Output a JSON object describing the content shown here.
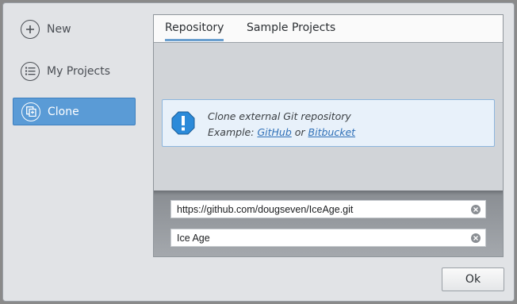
{
  "sidebar": {
    "items": [
      {
        "label": "New",
        "icon": "plus-circle-icon"
      },
      {
        "label": "My Projects",
        "icon": "list-icon"
      },
      {
        "label": "Clone",
        "icon": "clone-icon",
        "active": true
      }
    ]
  },
  "tabs": [
    {
      "label": "Repository",
      "active": true
    },
    {
      "label": "Sample Projects"
    }
  ],
  "info": {
    "line1": "Clone external Git repository",
    "example_prefix": "Example:",
    "link1": "GitHub",
    "or_text": "or",
    "link2": "Bitbucket",
    "icon": "exclamation-icon"
  },
  "fields": {
    "url_value": "https://github.com/dougseven/IceAge.git",
    "name_value": "Ice Age"
  },
  "buttons": {
    "ok_label": "Ok"
  },
  "colors": {
    "accent": "#5a9bd6",
    "info_bg": "#e8f1fa",
    "link": "#2e6fb7"
  }
}
